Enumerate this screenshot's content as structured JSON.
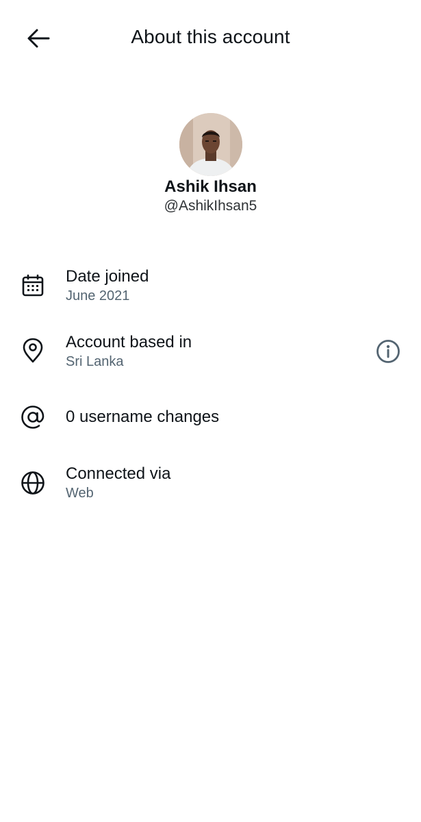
{
  "header": {
    "title": "About this account",
    "back_icon": "arrow-left-icon"
  },
  "profile": {
    "name": "Ashik Ihsan",
    "handle": "@AshikIhsan5"
  },
  "rows": [
    {
      "icon": "calendar-icon",
      "label": "Date joined",
      "value": "June 2021"
    },
    {
      "icon": "location-pin-icon",
      "label": "Account based in",
      "value": "Sri Lanka",
      "action_icon": "info-icon"
    },
    {
      "icon": "at-sign-icon",
      "label": "0 username changes"
    },
    {
      "icon": "globe-icon",
      "label": "Connected via",
      "value": "Web"
    }
  ],
  "colors": {
    "primary_text": "#0f1419",
    "secondary_text": "#536471",
    "background": "#ffffff"
  }
}
